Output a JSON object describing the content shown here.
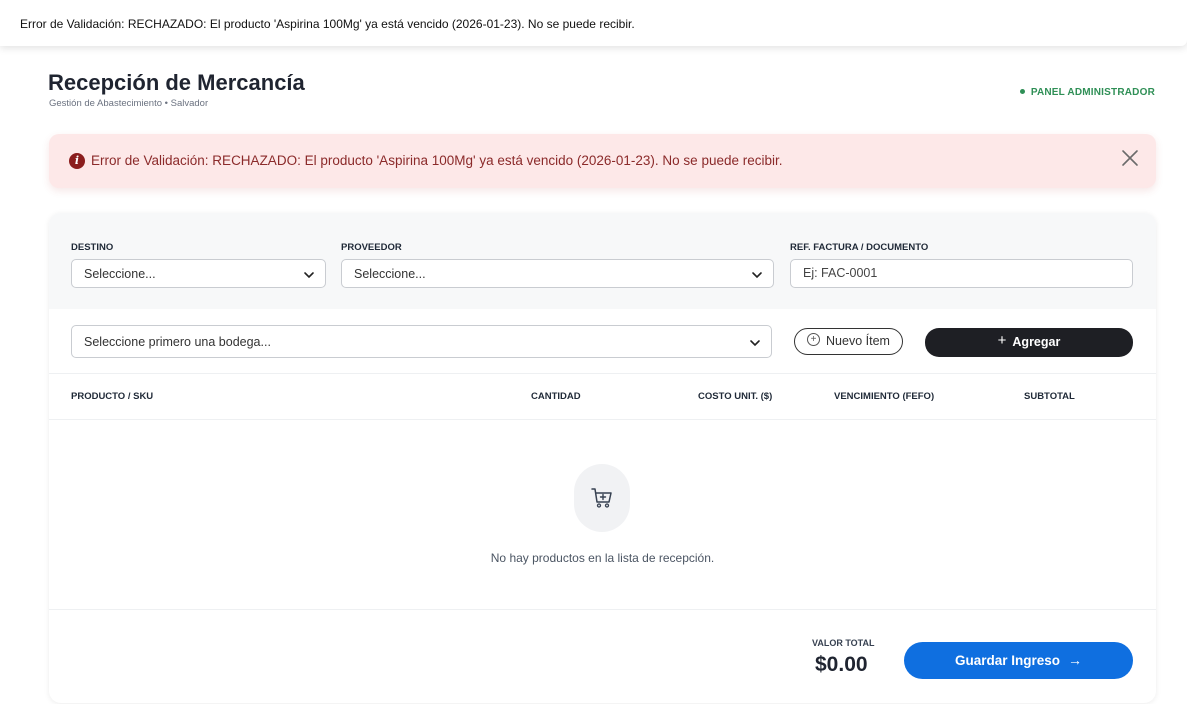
{
  "toast": {
    "message": "Error de Validación: RECHAZADO: El producto 'Aspirina 100Mg' ya está vencido (2026-01-23). No se puede recibir."
  },
  "header": {
    "title": "Recepción de Mercancía",
    "subtitle": "Gestión de Abastecimiento • Salvador",
    "badge": "PANEL ADMINISTRADOR"
  },
  "alert": {
    "message": "Error de Validación: RECHAZADO: El producto 'Aspirina 100Mg' ya está vencido (2026-01-23). No se puede recibir.",
    "icon": "info-icon"
  },
  "filters": {
    "destino_label": "DESTINO",
    "destino_value": "Seleccione...",
    "proveedor_label": "PROVEEDOR",
    "proveedor_value": "Seleccione...",
    "ref_label": "REF. FACTURA / DOCUMENTO",
    "ref_placeholder": "Ej: FAC-0001"
  },
  "add_row": {
    "product_select": "Seleccione primero una bodega...",
    "new_item_label": "Nuevo Ítem",
    "add_label": "Agregar"
  },
  "table": {
    "columns": [
      "PRODUCTO / SKU",
      "CANTIDAD",
      "COSTO UNIT. ($)",
      "VENCIMIENTO (FEFO)",
      "SUBTOTAL"
    ],
    "empty_message": "No hay productos en la lista de recepción."
  },
  "footer": {
    "total_label": "VALOR TOTAL",
    "total_value": "$0.00",
    "save_label": "Guardar Ingreso",
    "save_arrow": "→"
  },
  "colors": {
    "accent": "#0f6fe0",
    "success": "#2f8f56",
    "error_bg": "#fde8e8",
    "error_text": "#8b2a2a",
    "dark_button": "#1e1f24"
  }
}
